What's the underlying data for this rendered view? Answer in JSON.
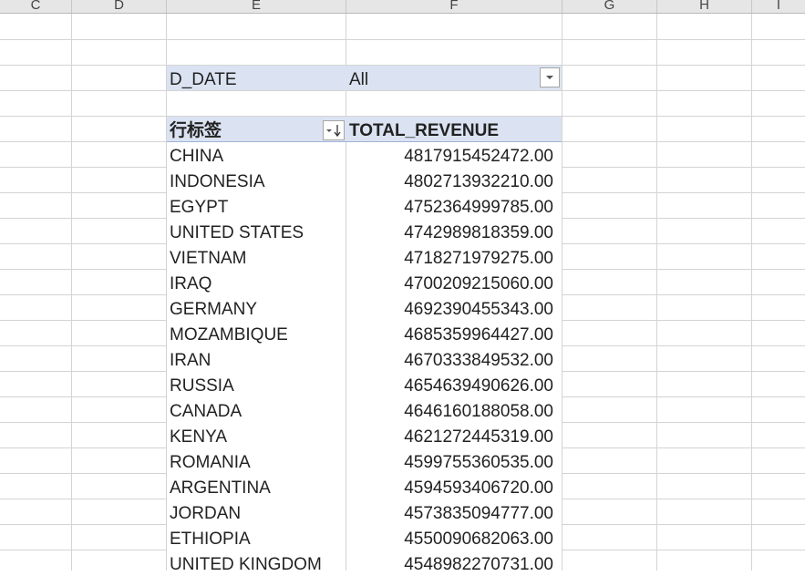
{
  "columns": [
    "C",
    "D",
    "E",
    "F",
    "G",
    "H",
    "I"
  ],
  "filter": {
    "field": "D_DATE",
    "value": "All"
  },
  "header": {
    "row_label": "行标签",
    "value_label": "TOTAL_REVENUE"
  },
  "rows": [
    {
      "label": "CHINA",
      "value": "4817915452472.00"
    },
    {
      "label": "INDONESIA",
      "value": "4802713932210.00"
    },
    {
      "label": "EGYPT",
      "value": "4752364999785.00"
    },
    {
      "label": "UNITED STATES",
      "value": "4742989818359.00"
    },
    {
      "label": "VIETNAM",
      "value": "4718271979275.00"
    },
    {
      "label": "IRAQ",
      "value": "4700209215060.00"
    },
    {
      "label": "GERMANY",
      "value": "4692390455343.00"
    },
    {
      "label": "MOZAMBIQUE",
      "value": "4685359964427.00"
    },
    {
      "label": "IRAN",
      "value": "4670333849532.00"
    },
    {
      "label": "RUSSIA",
      "value": "4654639490626.00"
    },
    {
      "label": "CANADA",
      "value": "4646160188058.00"
    },
    {
      "label": "KENYA",
      "value": "4621272445319.00"
    },
    {
      "label": "ROMANIA",
      "value": "4599755360535.00"
    },
    {
      "label": "ARGENTINA",
      "value": "4594593406720.00"
    },
    {
      "label": "JORDAN",
      "value": "4573835094777.00"
    },
    {
      "label": "ETHIOPIA",
      "value": "4550090682063.00"
    },
    {
      "label": "UNITED KINGDOM",
      "value": "4548982270731.00"
    }
  ]
}
